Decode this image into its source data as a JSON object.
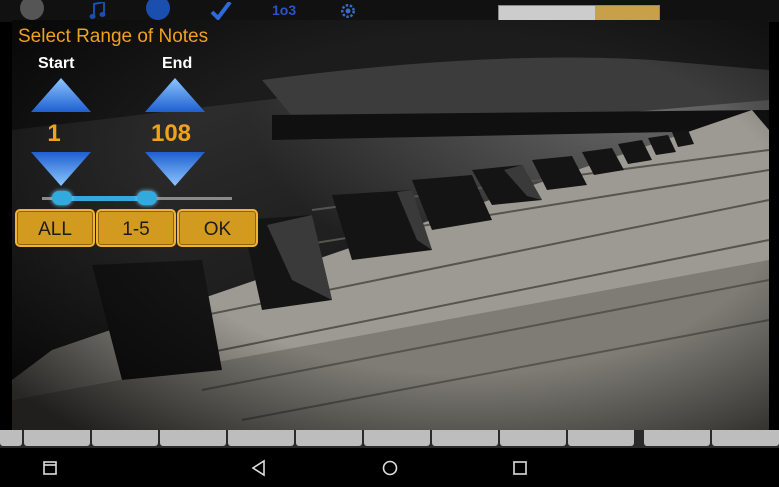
{
  "toolbar": {
    "icons": [
      "back-icon",
      "music-note-icon",
      "play-icon",
      "check-icon",
      "number-icon",
      "gear-icon",
      "keyboard-range-icon"
    ],
    "number_label": "1o3"
  },
  "dialog": {
    "title": "Select Range of Notes",
    "start_label": "Start",
    "end_label": "End",
    "start_value": "1",
    "end_value": "108",
    "range_slider": {
      "start_fraction": 0.06,
      "end_fraction": 0.56
    },
    "buttons": {
      "all": "ALL",
      "one_five": "1-5",
      "ok": "OK"
    }
  },
  "navbar": {
    "icons": [
      "recents-icon",
      "back-triangle-icon",
      "home-circle-icon",
      "overview-square-icon"
    ]
  },
  "colors": {
    "accent": "#f0a21c",
    "button_bg": "#d29a1e",
    "arrow_blue": "#2f7fe0",
    "slider_blue": "#33aadd"
  }
}
